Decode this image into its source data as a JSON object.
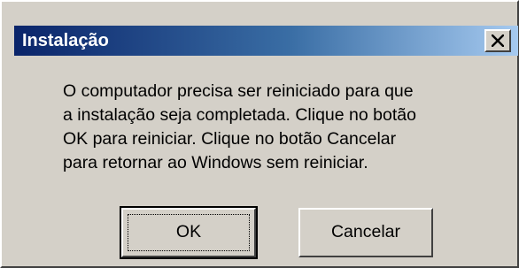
{
  "window": {
    "title": "Instalação",
    "close_icon": "close-icon"
  },
  "message": {
    "lines": [
      "O computador precisa ser reiniciado para que",
      "a instalação seja completada. Clique no botão",
      "OK para reiniciar. Clique no botão Cancelar",
      "para retornar ao Windows sem reiniciar."
    ]
  },
  "buttons": {
    "ok_label": "OK",
    "cancel_label": "Cancelar"
  },
  "colors": {
    "titlebar_start": "#0a246a",
    "titlebar_end": "#a6caf0",
    "face": "#d4d0c8"
  }
}
